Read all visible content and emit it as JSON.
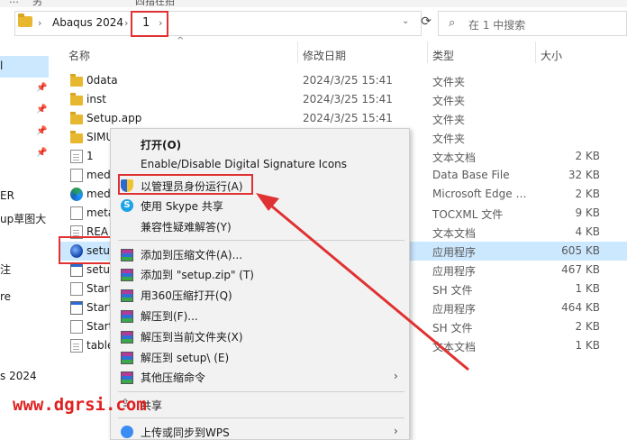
{
  "topstrip": {
    "left_fragment": "…",
    "mid_fragment": "另",
    "right_fragment": "四指在拍"
  },
  "address": {
    "crumb1": "Abaqus 2024",
    "current": "1",
    "separator": "›"
  },
  "refresh_glyph": "⟳",
  "search": {
    "placeholder": "在 1 中搜索"
  },
  "nav": {
    "items": [
      {
        "label": "l"
      },
      {
        "label": "ER"
      },
      {
        "label": "up草图大"
      },
      {
        "label": "注"
      },
      {
        "label": "re"
      },
      {
        "label": "s 2024"
      }
    ]
  },
  "columns": {
    "name": "名称",
    "date": "修改日期",
    "type": "类型",
    "size": "大小"
  },
  "rows": [
    {
      "name": "0data",
      "date": "2024/3/25 15:41",
      "type": "文件夹",
      "size": ""
    },
    {
      "name": "inst",
      "date": "2024/3/25 15:41",
      "type": "文件夹",
      "size": ""
    },
    {
      "name": "Setup.app",
      "date": "2024/3/25 15:41",
      "type": "文件夹",
      "size": ""
    },
    {
      "name": "SIMU",
      "date": "",
      "type": "文件夹",
      "size": ""
    },
    {
      "name": "1",
      "date": "",
      "type": "文本文档",
      "size": "2 KB"
    },
    {
      "name": "med",
      "date": "",
      "type": "Data Base File",
      "size": "32 KB"
    },
    {
      "name": "med",
      "date": "",
      "type": "Microsoft Edge …",
      "size": "2 KB"
    },
    {
      "name": "meta",
      "date": "",
      "type": "TOCXML 文件",
      "size": "9 KB"
    },
    {
      "name": "REA",
      "date": "",
      "type": "文本文档",
      "size": "4 KB"
    },
    {
      "name": "setu",
      "date": "",
      "type": "应用程序",
      "size": "605 KB"
    },
    {
      "name": "setu",
      "date": "",
      "type": "应用程序",
      "size": "467 KB"
    },
    {
      "name": "Start",
      "date": "",
      "type": "SH 文件",
      "size": "1 KB"
    },
    {
      "name": "Start",
      "date": "",
      "type": "应用程序",
      "size": "464 KB"
    },
    {
      "name": "Start",
      "date": "",
      "type": "SH 文件",
      "size": "2 KB"
    },
    {
      "name": "table",
      "date": "",
      "type": "文本文档",
      "size": "1 KB"
    }
  ],
  "menu": {
    "open": "打开(O)",
    "signature": "Enable/Disable Digital Signature Icons",
    "runas": "以管理员身份运行(A)",
    "skype": "使用 Skype 共享",
    "compat": "兼容性疑难解答(Y)",
    "add_archive": "添加到压缩文件(A)...",
    "add_zip": "添加到 \"setup.zip\" (T)",
    "open360": "用360压缩打开(Q)",
    "extract_to": "解压到(F)...",
    "extract_here": "解压到当前文件夹(X)",
    "extract_setup": "解压到 setup\\ (E)",
    "other": "其他压缩命令",
    "share": "共享",
    "wps": "上传或同步到WPS",
    "submenu_arrow": "›"
  },
  "watermark": "www.dgrsi.com",
  "colors": {
    "highlight_red": "#e03232",
    "selection": "#cce8ff"
  }
}
